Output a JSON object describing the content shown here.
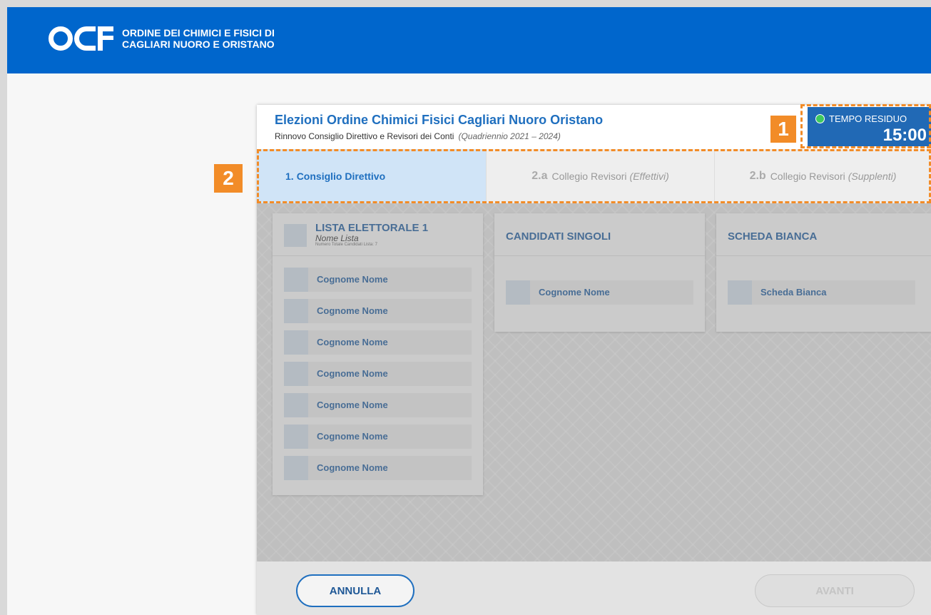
{
  "org": {
    "logo_text": "OCF",
    "name_line1": "ORDINE DEI CHIMICI E FISICI DI",
    "name_line2": "CAGLIARI NUORO E ORISTANO"
  },
  "election": {
    "title": "Elezioni Ordine Chimici Fisici Cagliari Nuoro Oristano",
    "subtitle": "Rinnovo Consiglio Direttivo e Revisori dei Conti",
    "period": "(Quadriennio 2021 – 2024)"
  },
  "timer": {
    "label": "TEMPO RESIDUO",
    "value": "15:00",
    "status_color": "#3dc95e"
  },
  "tabs": [
    {
      "num": "1.",
      "label": "Consiglio Direttivo",
      "extra": "",
      "active": true
    },
    {
      "num": "2.a",
      "label": "Collegio Revisori",
      "extra": "(Effettivi)",
      "active": false
    },
    {
      "num": "2.b",
      "label": "Collegio Revisori",
      "extra": "(Supplenti)",
      "active": false
    }
  ],
  "lista": {
    "title": "LISTA ELETTORALE 1",
    "subtitle": "Nome Lista",
    "count": "Numero Totale Candidati Lista: 7",
    "candidates": [
      "Cognome Nome",
      "Cognome Nome",
      "Cognome Nome",
      "Cognome Nome",
      "Cognome Nome",
      "Cognome Nome",
      "Cognome Nome"
    ]
  },
  "singoli": {
    "title": "CANDIDATI SINGOLI",
    "candidates": [
      "Cognome Nome"
    ]
  },
  "bianca": {
    "title": "SCHEDA BIANCA",
    "option": "Scheda Bianca"
  },
  "footer": {
    "cancel_label": "ANNULLA",
    "next_label": "AVANTI"
  },
  "markers": {
    "timer_marker": "1",
    "tabs_marker": "2"
  },
  "colors": {
    "brand_blue": "#0066cc",
    "marker_orange": "#f28c28"
  }
}
